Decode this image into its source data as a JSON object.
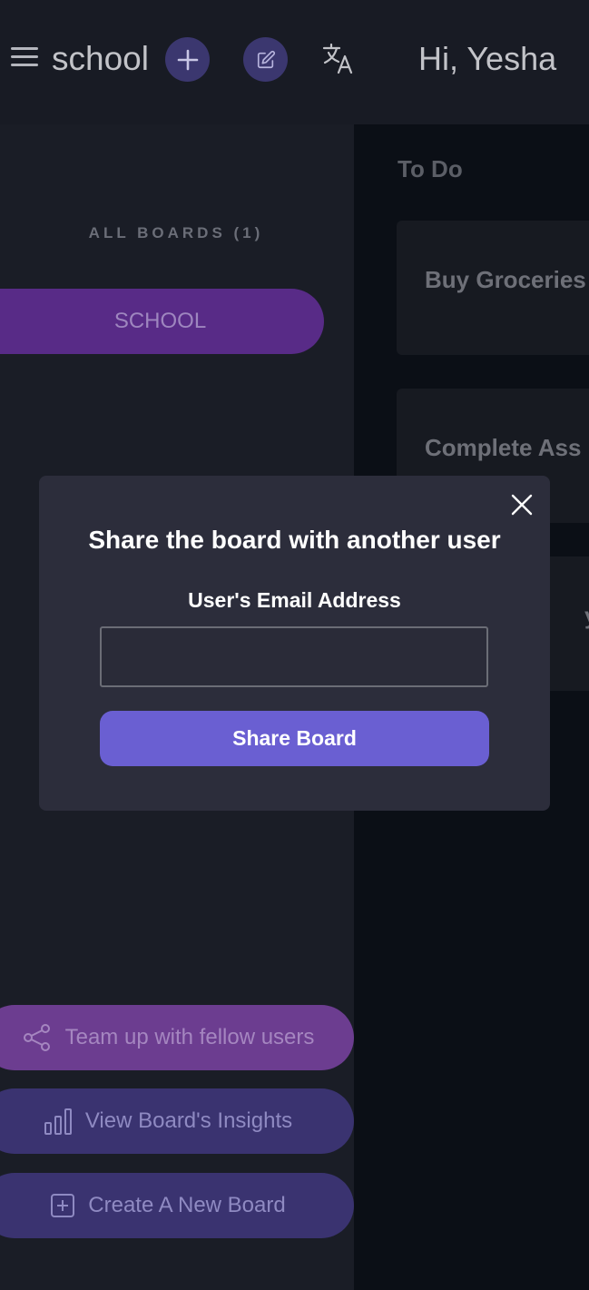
{
  "header": {
    "menu_icon": "hamburger-menu-icon",
    "board_title": "school",
    "add_icon": "plus-icon",
    "edit_icon": "pencil-square-icon",
    "translate_icon": "translate-icon",
    "greeting": "Hi, Yesha"
  },
  "sidebar": {
    "heading": "ALL BOARDS (1)",
    "boards": [
      "SCHOOL"
    ],
    "active_color": "#582b87",
    "actions": {
      "team_up": "Team up with fellow users",
      "insights": "View Board's Insights",
      "create": "Create A New Board"
    }
  },
  "main": {
    "column_title": "To Do",
    "tasks": [
      "Buy Groceries",
      "Complete Ass",
      "y"
    ]
  },
  "modal": {
    "title": "Share the board with another user",
    "email_label": "User's Email Address",
    "email_value": "",
    "button_label": "Share Board",
    "button_color": "#6a5fd2",
    "close_icon": "close-icon"
  }
}
